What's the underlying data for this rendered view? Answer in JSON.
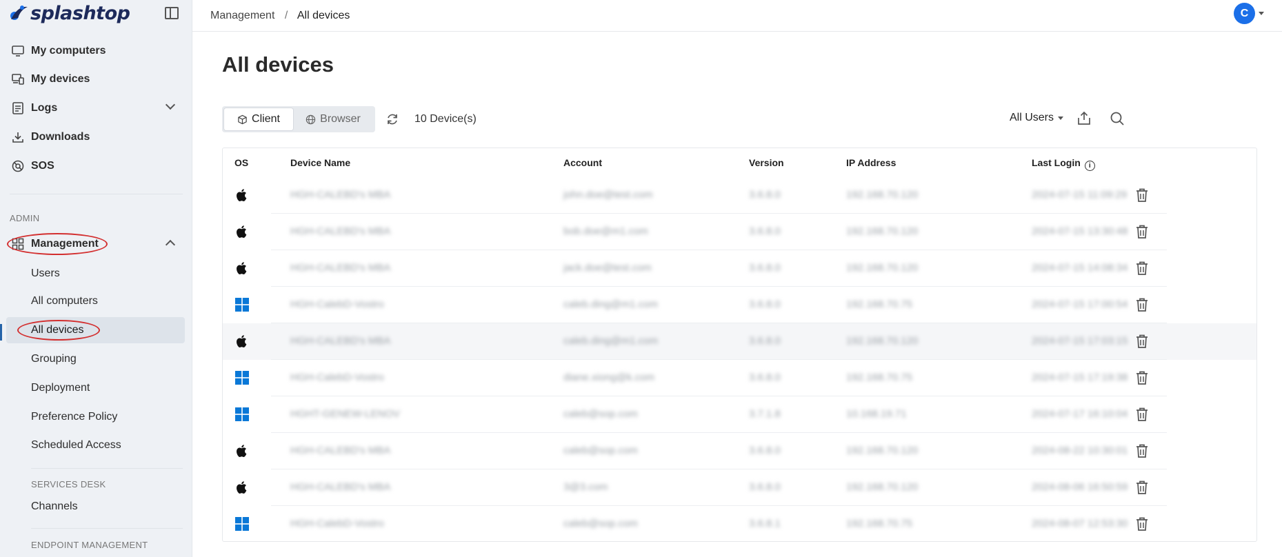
{
  "app": {
    "logo_text": "splashtop",
    "brand_color": "#1d2a5b",
    "accent_color": "#1b6fe8",
    "annotation_color": "#d32f2f"
  },
  "sidebar": {
    "nav": [
      {
        "label": "My computers",
        "icon": "monitor-icon"
      },
      {
        "label": "My devices",
        "icon": "devices-icon"
      },
      {
        "label": "Logs",
        "icon": "log-icon"
      },
      {
        "label": "Downloads",
        "icon": "download-icon"
      },
      {
        "label": "SOS",
        "icon": "sos-icon"
      }
    ],
    "admin_label": "ADMIN",
    "management_label": "Management",
    "management_sub": [
      {
        "label": "Users"
      },
      {
        "label": "All computers"
      },
      {
        "label": "All devices",
        "active": true
      },
      {
        "label": "Grouping"
      },
      {
        "label": "Deployment"
      },
      {
        "label": "Preference Policy"
      },
      {
        "label": "Scheduled Access"
      }
    ],
    "services_desk_label": "SERVICES DESK",
    "services_desk_items": [
      {
        "label": "Channels"
      }
    ],
    "endpoint_label": "ENDPOINT MANAGEMENT"
  },
  "header": {
    "breadcrumb_parent": "Management",
    "breadcrumb_sep": "/",
    "breadcrumb_current": "All devices",
    "avatar_letter": "C"
  },
  "main": {
    "title": "All devices",
    "tabs": [
      {
        "label": "Client",
        "selected": true
      },
      {
        "label": "Browser",
        "selected": false
      }
    ],
    "device_count": "10 Device(s)",
    "user_filter": "All Users",
    "columns": [
      "OS",
      "Device Name",
      "Account",
      "Version",
      "IP Address",
      "Last Login"
    ],
    "rows": [
      {
        "os": "apple",
        "device": "HGH-CALEBD's MBA",
        "account": "john.doe@test.com",
        "version": "3.6.8.0",
        "ip": "192.168.70.120",
        "last_login": "2024-07-15 11:09:29"
      },
      {
        "os": "apple",
        "device": "HGH-CALEBD's MBA",
        "account": "bob.doe@m1.com",
        "version": "3.6.8.0",
        "ip": "192.168.70.120",
        "last_login": "2024-07-15 13:30:48"
      },
      {
        "os": "apple",
        "device": "HGH-CALEBD's MBA",
        "account": "jack.doe@test.com",
        "version": "3.6.8.0",
        "ip": "192.168.70.120",
        "last_login": "2024-07-15 14:08:34"
      },
      {
        "os": "windows",
        "device": "HGH-CalebD-Vostro",
        "account": "caleb.ding@m1.com",
        "version": "3.6.8.0",
        "ip": "192.168.70.75",
        "last_login": "2024-07-15 17:00:54"
      },
      {
        "os": "apple",
        "device": "HGH-CALEBD's MBA",
        "account": "caleb.ding@m1.com",
        "version": "3.6.8.0",
        "ip": "192.168.70.120",
        "last_login": "2024-07-15 17:03:15"
      },
      {
        "os": "windows",
        "device": "HGH-CalebD-Vostro",
        "account": "diane.xiong@k.com",
        "version": "3.6.8.0",
        "ip": "192.168.70.75",
        "last_login": "2024-07-15 17:19:38"
      },
      {
        "os": "windows",
        "device": "HGHT-GENEW-LENOV",
        "account": "caleb@sop.com",
        "version": "3.7.1.8",
        "ip": "10.168.19.71",
        "last_login": "2024-07-17 16:10:04"
      },
      {
        "os": "apple",
        "device": "HGH-CALEBD's MBA",
        "account": "caleb@sop.com",
        "version": "3.6.8.0",
        "ip": "192.168.70.120",
        "last_login": "2024-08-22 10:30:01"
      },
      {
        "os": "apple",
        "device": "HGH-CALEBD's MBA",
        "account": "3@3.com",
        "version": "3.6.8.0",
        "ip": "192.168.70.120",
        "last_login": "2024-08-06 16:50:59"
      },
      {
        "os": "windows",
        "device": "HGH-CalebD-Vostro",
        "account": "caleb@sop.com",
        "version": "3.6.8.1",
        "ip": "192.168.70.75",
        "last_login": "2024-08-07 12:53:30"
      }
    ]
  }
}
